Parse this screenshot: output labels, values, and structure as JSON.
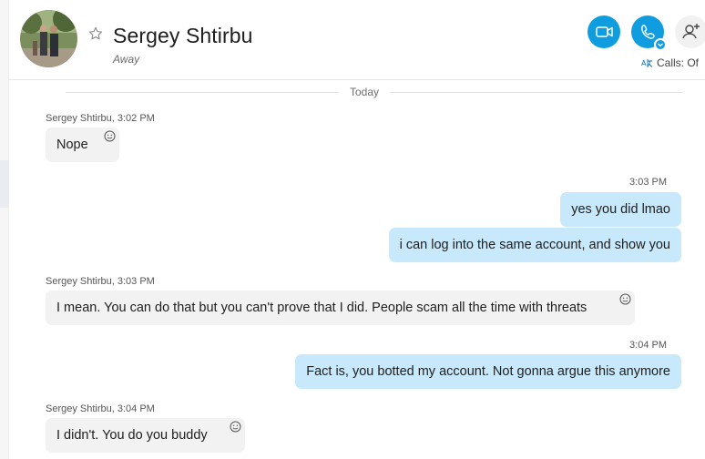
{
  "contact": {
    "name": "Sergey Shtirbu",
    "presence": "Away"
  },
  "header": {
    "calls_status": "Calls: Of"
  },
  "chat": {
    "day_separator": "Today",
    "messages": [
      {
        "direction": "incoming",
        "sender_line": "Sergey Shtirbu, 3:02 PM",
        "text": "Nope"
      },
      {
        "direction": "outgoing",
        "time": "3:03 PM",
        "text": "yes you did lmao"
      },
      {
        "direction": "outgoing",
        "text": "i can log into the same account, and show you"
      },
      {
        "direction": "incoming",
        "sender_line": "Sergey Shtirbu, 3:03 PM",
        "text": "I mean. You can do that but you can't prove that I did. People scam all the time with threats"
      },
      {
        "direction": "outgoing",
        "time": "3:04 PM",
        "text": "Fact is, you botted my account. Not gonna argue this anymore"
      },
      {
        "direction": "incoming",
        "sender_line": "Sergey Shtirbu, 3:04 PM",
        "text": "I didn't. You do you buddy"
      }
    ]
  },
  "icons": {
    "favorite": "star-outline-icon",
    "video_call": "video-camera-icon",
    "audio_call": "phone-icon",
    "add_people": "add-person-icon",
    "translate": "translate-icon",
    "reaction": "smiley-icon"
  },
  "colors": {
    "accent": "#0f9de0",
    "outgoing_bubble": "#c8e9fb",
    "incoming_bubble": "#f2f2f2"
  }
}
